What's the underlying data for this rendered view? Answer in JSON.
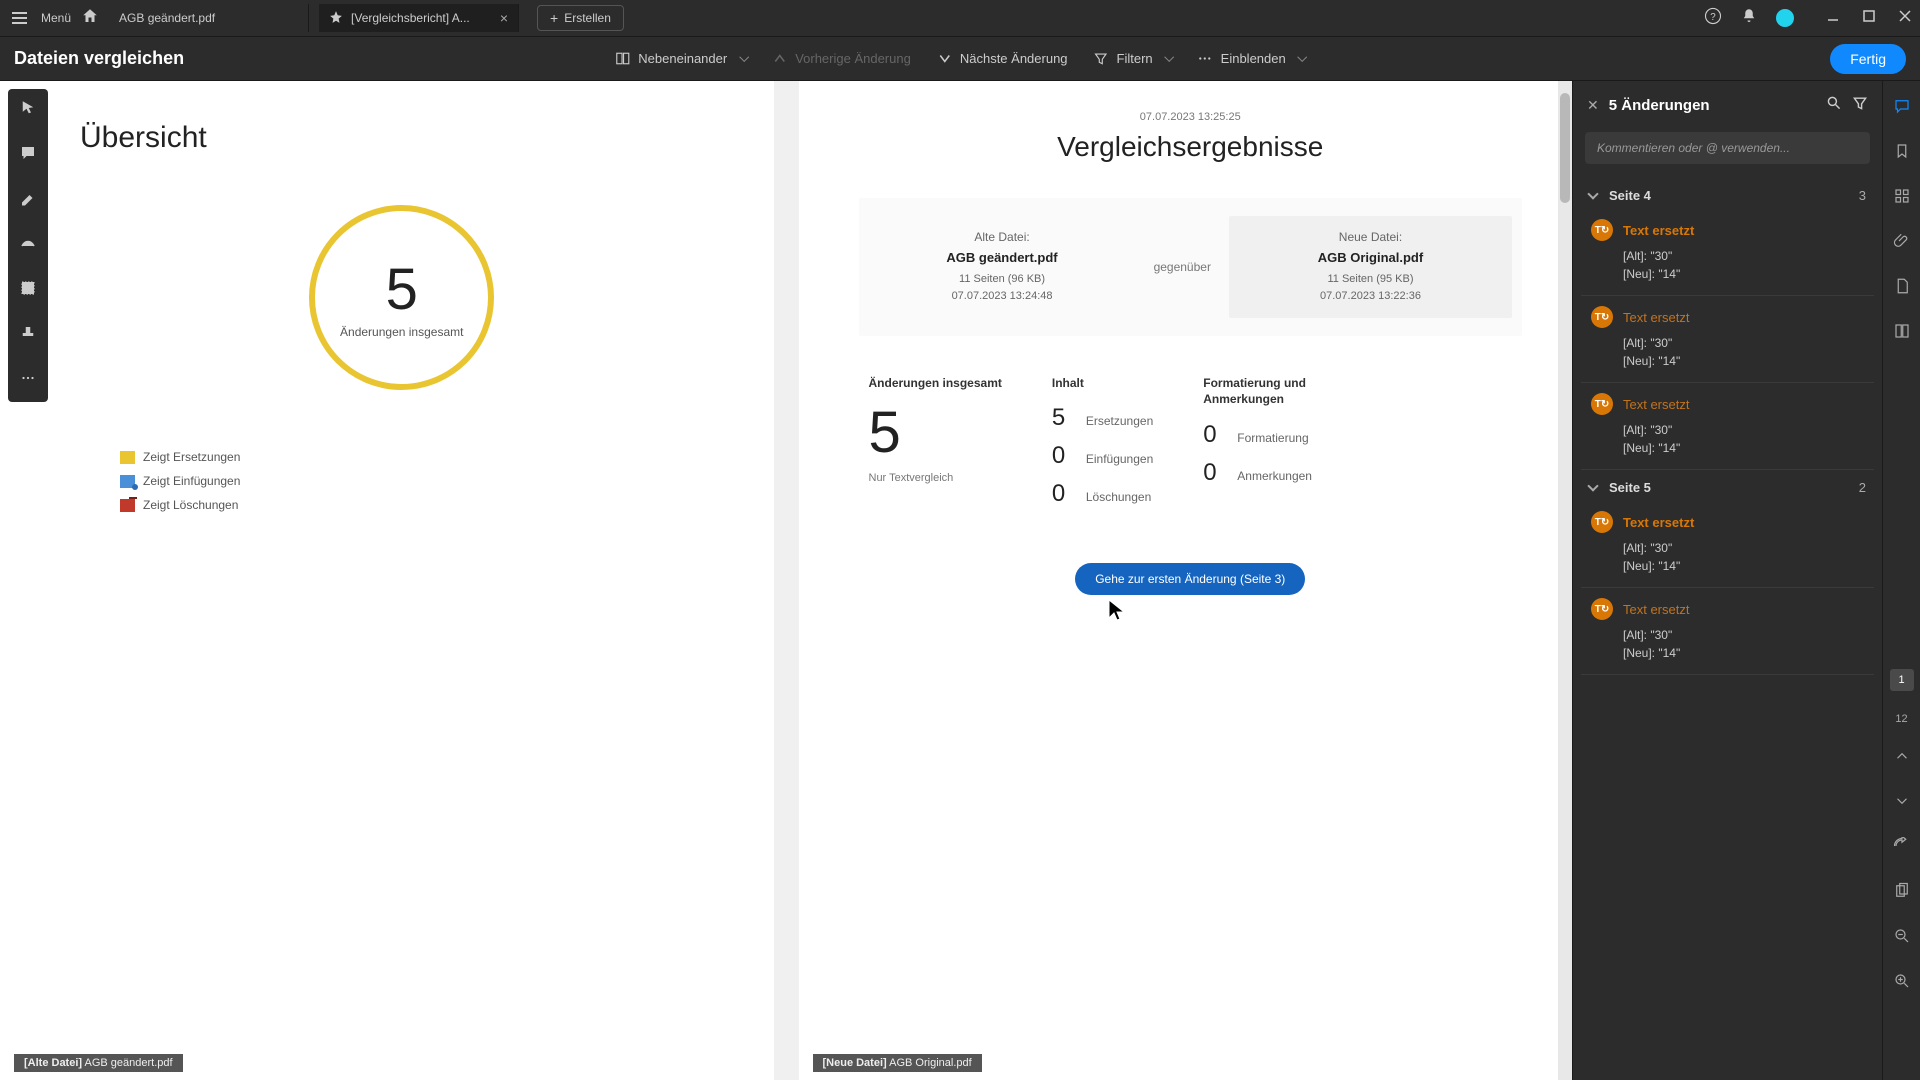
{
  "titlebar": {
    "menu": "Menü",
    "tab1": "AGB geändert.pdf",
    "tab2": "[Vergleichsbericht] A...",
    "create": "Erstellen"
  },
  "toolbar": {
    "title": "Dateien vergleichen",
    "side_by_side": "Nebeneinander",
    "prev_change": "Vorherige Änderung",
    "next_change": "Nächste Änderung",
    "filter": "Filtern",
    "show": "Einblenden",
    "done": "Fertig"
  },
  "overview": {
    "title": "Übersicht",
    "count": "5",
    "count_label": "Änderungen insgesamt",
    "legend_replace": "Zeigt Ersetzungen",
    "legend_insert": "Zeigt Einfügungen",
    "legend_delete": "Zeigt Löschungen"
  },
  "results": {
    "timestamp": "07.07.2023 13:25:25",
    "title": "Vergleichsergebnisse",
    "old_label": "Alte Datei:",
    "old_name": "AGB geändert.pdf",
    "old_meta1": "11 Seiten (96 KB)",
    "old_meta2": "07.07.2023 13:24:48",
    "vs": "gegenüber",
    "new_label": "Neue Datei:",
    "new_name": "AGB Original.pdf",
    "new_meta1": "11 Seiten (95 KB)",
    "new_meta2": "07.07.2023 13:22:36",
    "total_h": "Änderungen insgesamt",
    "total_n": "5",
    "total_sub": "Nur Textvergleich",
    "content_h": "Inhalt",
    "content_rows": [
      {
        "n": "5",
        "l": "Ersetzungen"
      },
      {
        "n": "0",
        "l": "Einfügungen"
      },
      {
        "n": "0",
        "l": "Löschungen"
      }
    ],
    "format_h": "Formatierung und Anmerkungen",
    "format_rows": [
      {
        "n": "0",
        "l": "Formatierung"
      },
      {
        "n": "0",
        "l": "Anmerkungen"
      }
    ],
    "goto": "Gehe zur ersten Änderung (Seite 3)"
  },
  "footer": {
    "left_label": "[Alte Datei]",
    "left_name": "AGB geändert.pdf",
    "right_label": "[Neue Datei]",
    "right_name": "AGB Original.pdf"
  },
  "panel": {
    "title": "5 Änderungen",
    "comment_ph": "Kommentieren oder @ verwenden...",
    "groups": [
      {
        "label": "Seite 4",
        "count": "3",
        "items": [
          {
            "title": "Text ersetzt",
            "bold": true,
            "alt": "[Alt]: \"30\"",
            "neu": "[Neu]: \"14\""
          },
          {
            "title": "Text ersetzt",
            "bold": false,
            "alt": "[Alt]: \"30\"",
            "neu": "[Neu]: \"14\""
          },
          {
            "title": "Text ersetzt",
            "bold": false,
            "alt": "[Alt]: \"30\"",
            "neu": "[Neu]: \"14\""
          }
        ]
      },
      {
        "label": "Seite 5",
        "count": "2",
        "items": [
          {
            "title": "Text ersetzt",
            "bold": true,
            "alt": "[Alt]: \"30\"",
            "neu": "[Neu]: \"14\""
          },
          {
            "title": "Text ersetzt",
            "bold": false,
            "alt": "[Alt]: \"30\"",
            "neu": "[Neu]: \"14\""
          }
        ]
      }
    ]
  },
  "rail": {
    "page": "1",
    "total": "12"
  }
}
